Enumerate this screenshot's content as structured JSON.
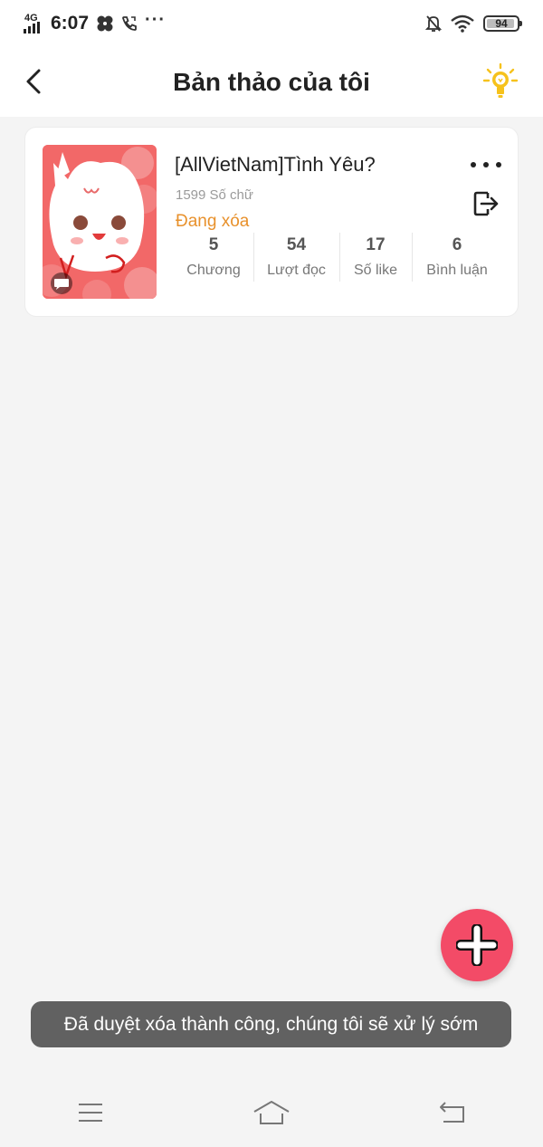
{
  "status_bar": {
    "network": "4G",
    "time": "6:07",
    "more": "···",
    "battery": "94",
    "battery_level": 0.94,
    "icons": [
      "signal-icon",
      "fan-icon",
      "call-icon",
      "bell-off-icon",
      "wifi-icon",
      "battery-icon"
    ]
  },
  "header": {
    "title": "Bản thảo của tôi",
    "back_icon": "chevron-left-icon",
    "tip_icon": "lightbulb-icon"
  },
  "story": {
    "title": "[AllVietNam]Tình Yêu?",
    "word_count": "1599 Số chữ",
    "status": "Đang xóa",
    "cover_icon": "chat-bubble-icon",
    "stats": [
      {
        "value": "5",
        "label": "Chương"
      },
      {
        "value": "54",
        "label": "Lượt đọc"
      },
      {
        "value": "17",
        "label": "Số like"
      },
      {
        "value": "6",
        "label": "Bình luận"
      }
    ]
  },
  "toast": "Đã duyệt xóa thành công, chúng tôi sẽ xử lý sớm",
  "colors": {
    "accent": "#f34b67",
    "status_orange": "#e8912c",
    "background": "#f4f4f4",
    "tip_yellow": "#f6c21c",
    "cover_red": "#f26868"
  },
  "nav_icons": [
    "menu-icon",
    "home-icon",
    "return-icon"
  ]
}
